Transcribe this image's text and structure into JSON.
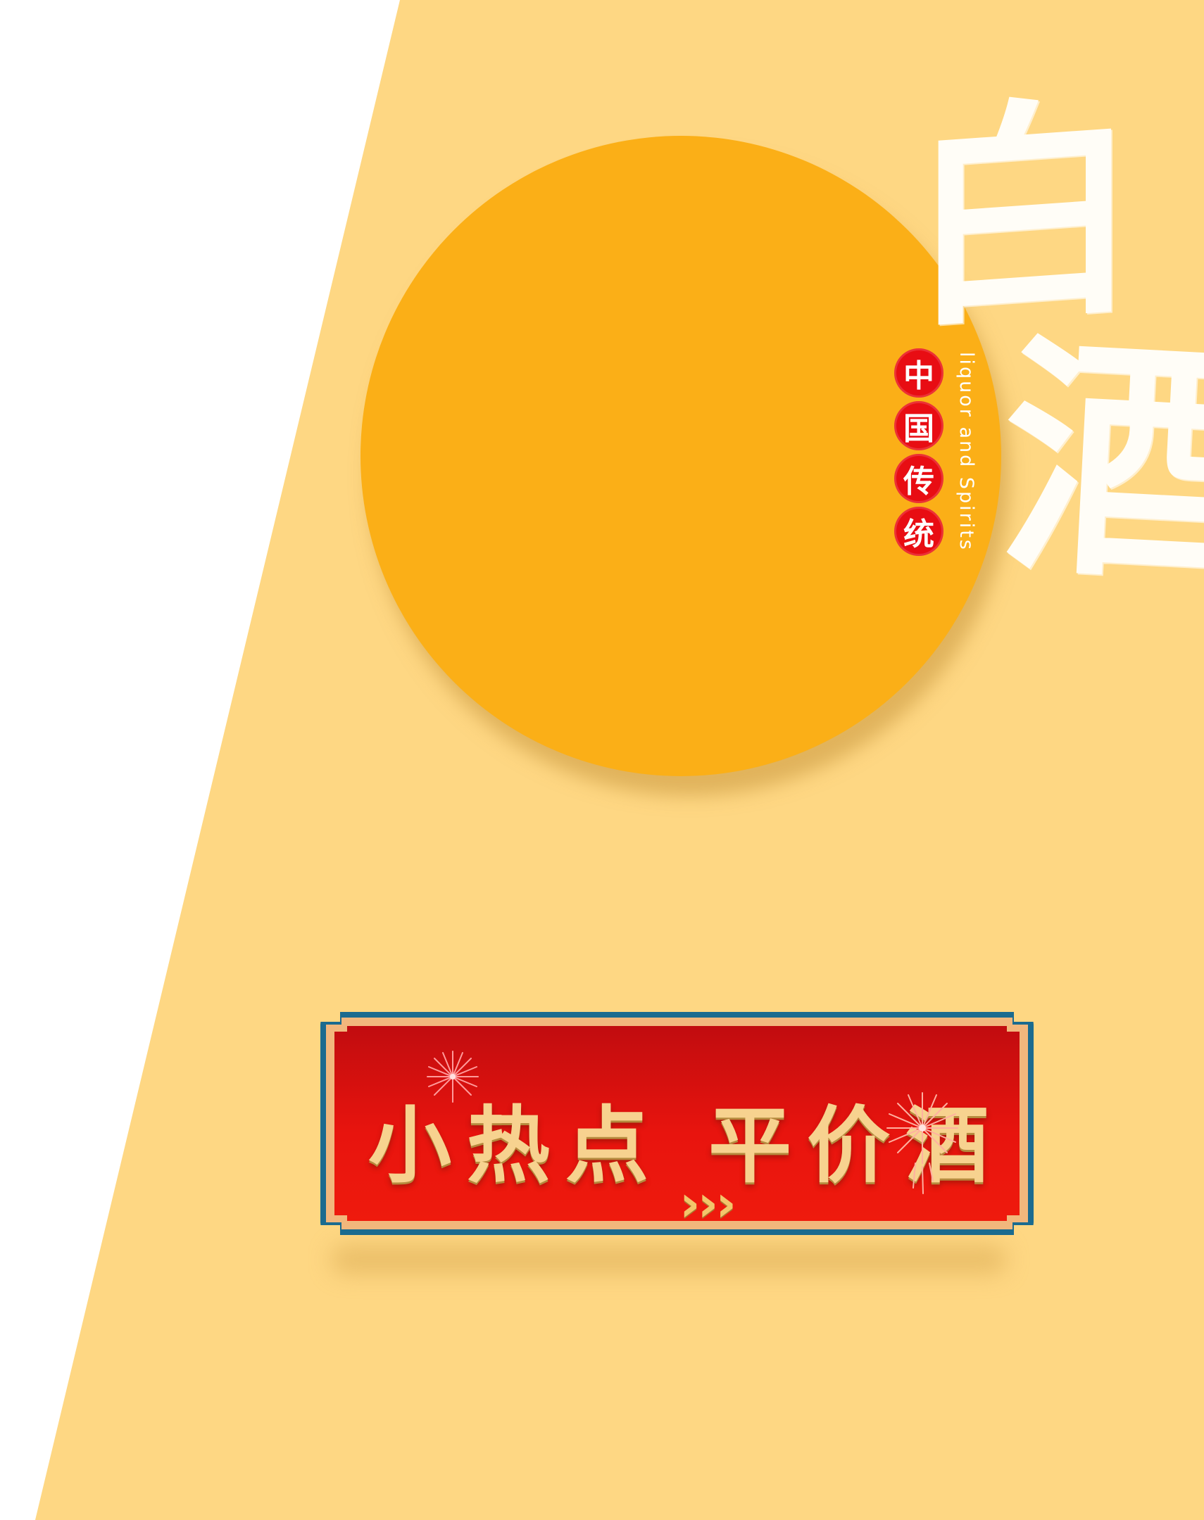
{
  "poster": {
    "colors": {
      "background_white": "#ffffff",
      "background_yellow": "#fed783",
      "sun_orange": "#fbaf17",
      "badge_red": "#e80d13",
      "banner_red": "#e8140e",
      "banner_frame": "#1b6b8f",
      "banner_text_gold": "#f7d28f"
    },
    "title_char_1": "白",
    "title_char_2": "酒",
    "english_tagline": "liquor and Spirits",
    "badges": [
      "中",
      "国",
      "传",
      "统"
    ]
  },
  "banner": {
    "title": "小热点 平价酒",
    "arrows": "›››",
    "icons": [
      "firework-icon",
      "firework-icon"
    ]
  }
}
